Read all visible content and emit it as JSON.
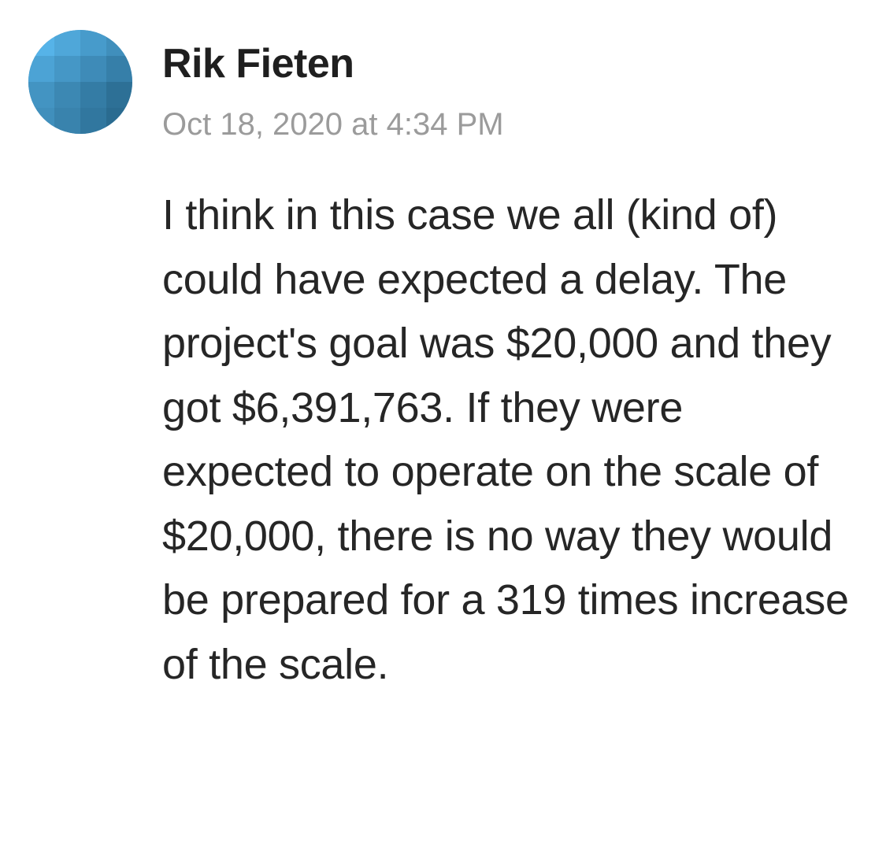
{
  "comment": {
    "author": "Rik Fieten",
    "timestamp": "Oct 18, 2020 at 4:34 PM",
    "body": "I think in this case we all (kind of) could have expected a delay. The project's goal was $20,000 and they got $6,391,763. If they were expected to operate on the scale of $20,000, there is no way they would be prepared for a 319 times increase of the scale.",
    "avatar_icon": "user-avatar-icon"
  },
  "colors": {
    "author_text": "#1f1f1f",
    "timestamp_text": "#9b9b9b",
    "body_text": "#262626",
    "avatar_blue_light": "#56b3e8",
    "avatar_blue_dark": "#2a6b90"
  }
}
